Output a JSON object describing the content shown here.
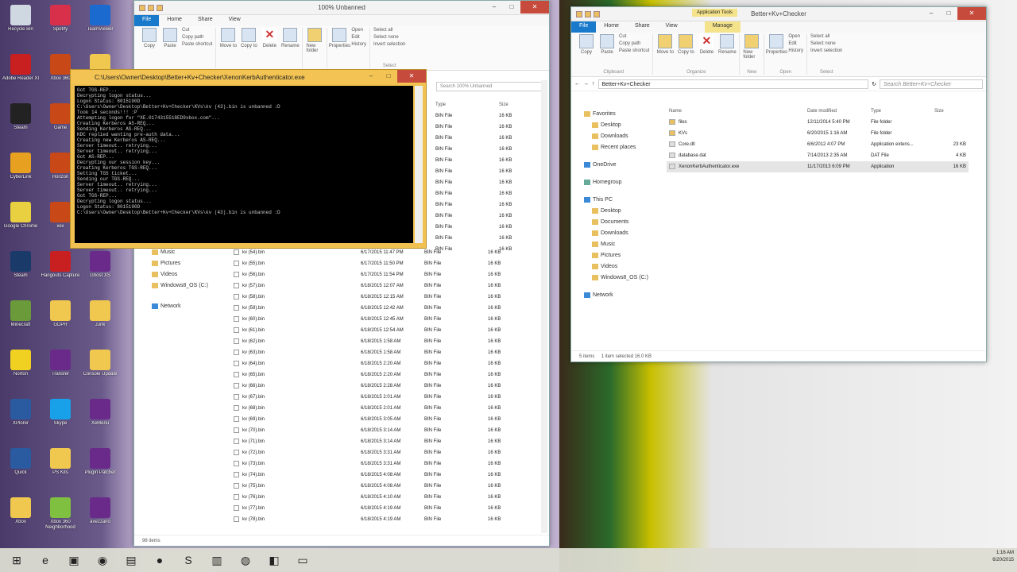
{
  "desktop_icons": [
    {
      "label": "Recycle Bin",
      "icon": "recycle-bin-icon",
      "color": "#cfd8e0"
    },
    {
      "label": "Spotify",
      "icon": "music-icon",
      "color": "#d8304a"
    },
    {
      "label": "TeamViewer",
      "icon": "teamviewer-icon",
      "color": "#1a6ad0"
    },
    {
      "label": "Adobe Reader XI",
      "icon": "pdf-icon",
      "color": "#c82020"
    },
    {
      "label": "Xbox 360",
      "icon": "game-icon",
      "color": "#c84818"
    },
    {
      "label": "Folder",
      "icon": "folder-icon",
      "color": "#f0c850"
    },
    {
      "label": "Steam",
      "icon": "steam-icon",
      "color": "#222"
    },
    {
      "label": "Game",
      "icon": "game-icon",
      "color": "#c84818"
    },
    {
      "label": "",
      "icon": "folder-icon",
      "color": "#f0c850"
    },
    {
      "label": "CyberLink",
      "icon": "app-icon",
      "color": "#e8a020"
    },
    {
      "label": "Horizon",
      "icon": "game-icon",
      "color": "#c84818"
    },
    {
      "label": "",
      "icon": "folder-icon",
      "color": "#f0c850"
    },
    {
      "label": "Google Chrome",
      "icon": "chrome-icon",
      "color": "#e8d040"
    },
    {
      "label": "xex",
      "icon": "game-icon",
      "color": "#c84818"
    },
    {
      "label": "",
      "icon": "folder-icon",
      "color": "#f0c850"
    },
    {
      "label": "Steam",
      "icon": "steam-icon",
      "color": "#1a3a6a"
    },
    {
      "label": "Hangouts Capture",
      "icon": "record-icon",
      "color": "#c82020"
    },
    {
      "label": "Ghost XS",
      "icon": "rar-icon",
      "color": "#6a2a8a"
    },
    {
      "label": "Minecraft",
      "icon": "minecraft-icon",
      "color": "#6a9a3a"
    },
    {
      "label": "GDPR",
      "icon": "folder-icon",
      "color": "#f0c850"
    },
    {
      "label": "Junk",
      "icon": "folder-icon",
      "color": "#f0c850"
    },
    {
      "label": "Norton",
      "icon": "norton-icon",
      "color": "#f0d020"
    },
    {
      "label": "Transfer",
      "icon": "rar-icon",
      "color": "#6a2a8a"
    },
    {
      "label": "Console Update",
      "icon": "folder-icon",
      "color": "#f0c850"
    },
    {
      "label": "XPlorer",
      "icon": "xplorer-icon",
      "color": "#2a5aa0"
    },
    {
      "label": "Skype",
      "icon": "skype-icon",
      "color": "#18a0e8"
    },
    {
      "label": "XeMenu",
      "icon": "rar-icon",
      "color": "#6a2a8a"
    },
    {
      "label": "Quick",
      "icon": "quick-icon",
      "color": "#2a5aa0"
    },
    {
      "label": "PS Kits",
      "icon": "folder-icon",
      "color": "#f0c850"
    },
    {
      "label": "Plugin Patcher",
      "icon": "rar-icon",
      "color": "#6a2a8a"
    },
    {
      "label": "Xbox",
      "icon": "folder-icon",
      "color": "#f0c850"
    },
    {
      "label": "Xbox 360 Neighborhood",
      "icon": "xbox-icon",
      "color": "#80c040"
    },
    {
      "label": "avezzano",
      "icon": "rar-icon",
      "color": "#6a2a8a"
    }
  ],
  "left_window": {
    "title": "100% Unbanned",
    "tabs": [
      "File",
      "Home",
      "Share",
      "View"
    ],
    "ribbon": {
      "copy": "Copy",
      "paste": "Paste",
      "cut": "Cut",
      "copy_path": "Copy path",
      "paste_shortcut": "Paste shortcut",
      "move_to": "Move to",
      "copy_to": "Copy to",
      "delete": "Delete",
      "rename": "Rename",
      "new_folder": "New folder",
      "properties": "Properties",
      "open": "Open",
      "edit": "Edit",
      "history": "History",
      "select_all": "Select all",
      "select_none": "Select none",
      "invert_selection": "Invert selection",
      "group_select": "Select"
    },
    "search_placeholder": "Search 100% Unbanned",
    "col_type": "Type",
    "col_size": "Size",
    "nav": [
      {
        "label": "Music",
        "icon": "music-folder-icon"
      },
      {
        "label": "Pictures",
        "icon": "pictures-folder-icon"
      },
      {
        "label": "Videos",
        "icon": "videos-folder-icon"
      },
      {
        "label": "Windows8_OS (C:)",
        "icon": "drive-icon"
      },
      {
        "label": "Network",
        "icon": "network-icon"
      }
    ],
    "files_top": [
      {
        "type": "BIN File",
        "size": "16 KB"
      },
      {
        "type": "BIN File",
        "size": "16 KB"
      },
      {
        "type": "BIN File",
        "size": "16 KB"
      },
      {
        "type": "BIN File",
        "size": "16 KB"
      },
      {
        "type": "BIN File",
        "size": "16 KB"
      },
      {
        "type": "BIN File",
        "size": "16 KB"
      },
      {
        "type": "BIN File",
        "size": "16 KB"
      },
      {
        "type": "BIN File",
        "size": "16 KB"
      },
      {
        "type": "BIN File",
        "size": "16 KB"
      },
      {
        "type": "BIN File",
        "size": "16 KB"
      },
      {
        "type": "BIN File",
        "size": "16 KB"
      },
      {
        "type": "BIN File",
        "size": "16 KB"
      },
      {
        "type": "BIN File",
        "size": "16 KB"
      }
    ],
    "files": [
      {
        "name": "kv (54).bin",
        "date": "6/17/2015 11:47 PM",
        "type": "BIN File",
        "size": "16 KB"
      },
      {
        "name": "kv (55).bin",
        "date": "6/17/2015 11:50 PM",
        "type": "BIN File",
        "size": "16 KB"
      },
      {
        "name": "kv (56).bin",
        "date": "6/17/2015 11:54 PM",
        "type": "BIN File",
        "size": "16 KB"
      },
      {
        "name": "kv (57).bin",
        "date": "6/18/2015 12:07 AM",
        "type": "BIN File",
        "size": "16 KB"
      },
      {
        "name": "kv (58).bin",
        "date": "6/18/2015 12:15 AM",
        "type": "BIN File",
        "size": "16 KB"
      },
      {
        "name": "kv (59).bin",
        "date": "6/18/2015 12:42 AM",
        "type": "BIN File",
        "size": "16 KB"
      },
      {
        "name": "kv (60).bin",
        "date": "6/18/2015 12:45 AM",
        "type": "BIN File",
        "size": "16 KB"
      },
      {
        "name": "kv (61).bin",
        "date": "6/18/2015 12:54 AM",
        "type": "BIN File",
        "size": "16 KB"
      },
      {
        "name": "kv (62).bin",
        "date": "6/18/2015 1:58 AM",
        "type": "BIN File",
        "size": "16 KB"
      },
      {
        "name": "kv (63).bin",
        "date": "6/18/2015 1:58 AM",
        "type": "BIN File",
        "size": "16 KB"
      },
      {
        "name": "kv (64).bin",
        "date": "6/18/2015 2:20 AM",
        "type": "BIN File",
        "size": "16 KB"
      },
      {
        "name": "kv (65).bin",
        "date": "6/18/2015 2:20 AM",
        "type": "BIN File",
        "size": "16 KB"
      },
      {
        "name": "kv (66).bin",
        "date": "6/18/2015 2:28 AM",
        "type": "BIN File",
        "size": "16 KB"
      },
      {
        "name": "kv (67).bin",
        "date": "6/18/2015 2:01 AM",
        "type": "BIN File",
        "size": "16 KB"
      },
      {
        "name": "kv (68).bin",
        "date": "6/18/2015 2:01 AM",
        "type": "BIN File",
        "size": "16 KB"
      },
      {
        "name": "kv (69).bin",
        "date": "6/18/2015 3:05 AM",
        "type": "BIN File",
        "size": "16 KB"
      },
      {
        "name": "kv (70).bin",
        "date": "6/18/2015 3:14 AM",
        "type": "BIN File",
        "size": "16 KB"
      },
      {
        "name": "kv (71).bin",
        "date": "6/18/2015 3:14 AM",
        "type": "BIN File",
        "size": "16 KB"
      },
      {
        "name": "kv (72).bin",
        "date": "6/18/2015 3:31 AM",
        "type": "BIN File",
        "size": "16 KB"
      },
      {
        "name": "kv (73).bin",
        "date": "6/18/2015 3:31 AM",
        "type": "BIN File",
        "size": "16 KB"
      },
      {
        "name": "kv (74).bin",
        "date": "6/18/2015 4:08 AM",
        "type": "BIN File",
        "size": "16 KB"
      },
      {
        "name": "kv (75).bin",
        "date": "6/18/2015 4:08 AM",
        "type": "BIN File",
        "size": "16 KB"
      },
      {
        "name": "kv (76).bin",
        "date": "6/18/2015 4:10 AM",
        "type": "BIN File",
        "size": "16 KB"
      },
      {
        "name": "kv (77).bin",
        "date": "6/18/2015 4:19 AM",
        "type": "BIN File",
        "size": "16 KB"
      },
      {
        "name": "kv (78).bin",
        "date": "6/18/2015 4:19 AM",
        "type": "BIN File",
        "size": "16 KB"
      }
    ],
    "status": "98 items"
  },
  "cmd_window": {
    "title": "C:\\Users\\Owner\\Desktop\\Better+Kv+Checker\\XenonKerbAuthenticator.exe",
    "lines": [
      "Got TGS-REP...",
      "Decrypting logon status...",
      "Logon Status: 8015190D",
      "C:\\Users\\Owner\\Desktop\\Better+Kv+Checker\\KVs\\kv (43).bin is unbanned :D",
      "Took 14 seconds!!! :P",
      "Attempting logon for \"XE.0174315518ED9xbox.com\"...",
      "Creating Kerberos AS-REQ...",
      "Sending Kerberos AS-REQ...",
      "KDC replied wanting pre-auth data...",
      "Creating new Kerberos AS-REQ...",
      "Server timeout.. retrying...",
      "Server timeout.. retrying...",
      "Got AS-REP...",
      "Decrypting our session key...",
      "Creating Kerberos TGS-REQ...",
      "Setting TGS ticket...",
      "Sending our TGS-REQ...",
      "Server timeout.. retrying...",
      "Server timeout.. retrying...",
      "Got TGS-REP...",
      "Decrypting logon status...",
      "Logon Status: 8015190D",
      "C:\\Users\\Owner\\Desktop\\Better+Kv+Checker\\KVs\\kv (43).bin is unbanned :D"
    ]
  },
  "right_window": {
    "title": "Better+Kv+Checker",
    "context_tab": "Application Tools",
    "tabs": [
      "File",
      "Home",
      "Share",
      "View",
      "Manage"
    ],
    "ribbon": {
      "copy": "Copy",
      "paste": "Paste",
      "cut": "Cut",
      "copy_path": "Copy path",
      "paste_shortcut": "Paste shortcut",
      "move_to": "Move to",
      "copy_to": "Copy to",
      "delete": "Delete",
      "rename": "Rename",
      "new_folder": "New folder",
      "properties": "Properties",
      "open": "Open",
      "edit": "Edit",
      "history": "History",
      "select_all": "Select all",
      "select_none": "Select none",
      "invert_selection": "Invert selection",
      "group_clipboard": "Clipboard",
      "group_organize": "Organize",
      "group_new": "New",
      "group_open": "Open",
      "group_select": "Select"
    },
    "address": "Better+Kv+Checker",
    "search_placeholder": "Search Better+Kv+Checker",
    "columns": {
      "name": "Name",
      "date": "Date modified",
      "type": "Type",
      "size": "Size"
    },
    "files": [
      {
        "name": "files",
        "date": "12/11/2014 5:40 PM",
        "type": "File folder",
        "size": "",
        "icon": "folder-icon"
      },
      {
        "name": "KVs",
        "date": "6/20/2015 1:16 AM",
        "type": "File folder",
        "size": "",
        "icon": "folder-icon"
      },
      {
        "name": "Core.dll",
        "date": "6/6/2012 4:07 PM",
        "type": "Application extens...",
        "size": "23 KB",
        "icon": "dll-icon"
      },
      {
        "name": "database.dat",
        "date": "7/14/2013 2:35 AM",
        "type": "DAT File",
        "size": "4 KB",
        "icon": "file-icon"
      },
      {
        "name": "XenonKerbAuthenticator.exe",
        "date": "11/17/2013 6:09 PM",
        "type": "Application",
        "size": "16 KB",
        "icon": "exe-icon"
      }
    ],
    "nav": [
      {
        "label": "Favorites",
        "icon": "star-icon"
      },
      {
        "label": "Desktop",
        "icon": "desktop-icon"
      },
      {
        "label": "Downloads",
        "icon": "downloads-icon"
      },
      {
        "label": "Recent places",
        "icon": "recent-icon"
      },
      {
        "label": "OneDrive",
        "icon": "onedrive-icon"
      },
      {
        "label": "Homegroup",
        "icon": "homegroup-icon"
      },
      {
        "label": "This PC",
        "icon": "pc-icon"
      },
      {
        "label": "Desktop",
        "icon": "desktop-icon"
      },
      {
        "label": "Documents",
        "icon": "documents-icon"
      },
      {
        "label": "Downloads",
        "icon": "downloads-icon"
      },
      {
        "label": "Music",
        "icon": "music-folder-icon"
      },
      {
        "label": "Pictures",
        "icon": "pictures-folder-icon"
      },
      {
        "label": "Videos",
        "icon": "videos-folder-icon"
      },
      {
        "label": "Windows8_OS (C:)",
        "icon": "drive-icon"
      },
      {
        "label": "Network",
        "icon": "network-icon"
      }
    ],
    "status_items": "5 items",
    "status_selected": "1 item selected  16.0 KB"
  },
  "taskbar": {
    "items": [
      {
        "icon": "windows-start-icon",
        "glyph": "⊞"
      },
      {
        "icon": "ie-icon",
        "glyph": "e"
      },
      {
        "icon": "explorer-icon",
        "glyph": "▣"
      },
      {
        "icon": "chrome-icon",
        "glyph": "◉"
      },
      {
        "icon": "xbox-neighborhood-icon",
        "glyph": "▤"
      },
      {
        "icon": "record-icon",
        "glyph": "●"
      },
      {
        "icon": "skype-icon",
        "glyph": "S"
      },
      {
        "icon": "winrar-icon",
        "glyph": "▥"
      },
      {
        "icon": "steam-icon",
        "glyph": "◍"
      },
      {
        "icon": "remote-icon",
        "glyph": "◧"
      },
      {
        "icon": "terminal-icon",
        "glyph": "▭"
      }
    ],
    "time": "1:16 AM",
    "date": "6/20/2015"
  }
}
